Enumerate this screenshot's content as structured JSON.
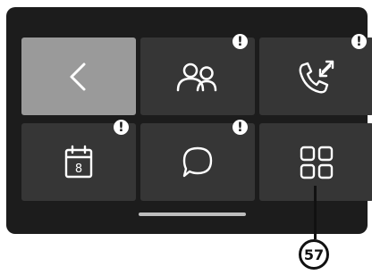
{
  "tiles": [
    {
      "name": "back",
      "icon": "chevron-left-icon",
      "badge": ""
    },
    {
      "name": "contacts",
      "icon": "contacts-icon",
      "badge": "!"
    },
    {
      "name": "calls",
      "icon": "phone-call-arrows-icon",
      "badge": "!"
    },
    {
      "name": "calendar",
      "icon": "calendar-icon",
      "calendar_day": "8",
      "badge": "!"
    },
    {
      "name": "messages",
      "icon": "chat-bubble-icon",
      "badge": "!"
    },
    {
      "name": "apps",
      "icon": "grid-apps-icon",
      "badge": ""
    }
  ],
  "callout": {
    "number": "57"
  },
  "colors": {
    "tile": "#363636",
    "tile_active": "#9a9a9a",
    "background": "#1c1c1c",
    "icon": "#ffffff"
  }
}
